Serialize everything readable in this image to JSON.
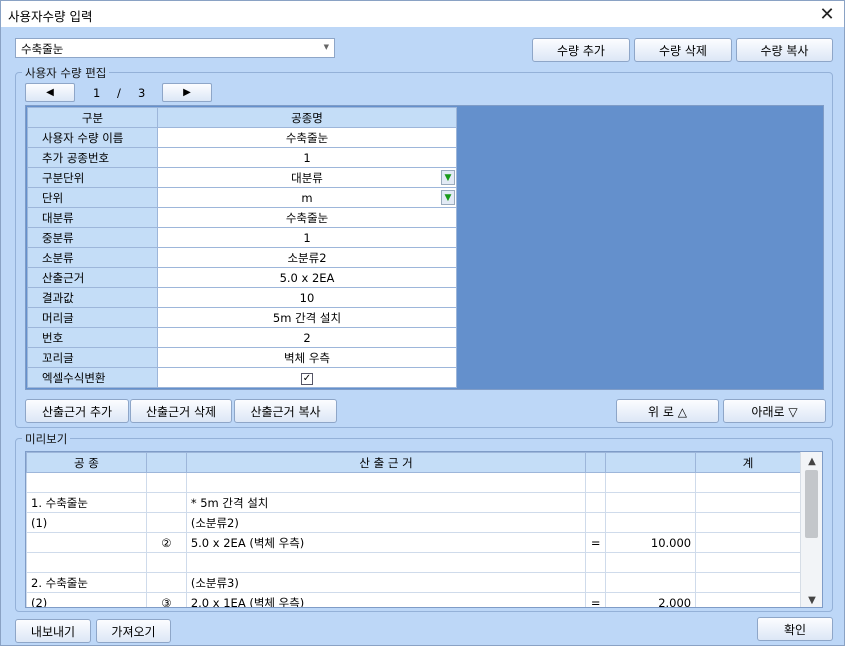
{
  "window": {
    "title": "사용자수량 입력",
    "close_symbol": "✕"
  },
  "selector": {
    "value": "수축줄눈",
    "arrow": "▼"
  },
  "top_buttons": {
    "add": "수량 추가",
    "delete": "수량 삭제",
    "copy": "수량 복사"
  },
  "editor": {
    "group_label": "사용자 수량 편집",
    "prev_symbol": "◀",
    "next_symbol": "▶",
    "page_current": "1",
    "page_sep": "/",
    "page_total": "3",
    "header": {
      "col1": "구분",
      "col2": "공종명"
    },
    "rows": [
      {
        "key": "사용자 수량 이름",
        "value": "수축줄눈"
      },
      {
        "key": "추가 공종번호",
        "value": "1"
      },
      {
        "key": "구분단위",
        "value": "대분류"
      },
      {
        "key": "단위",
        "value": "m"
      },
      {
        "key": "대분류",
        "value": "수축줄눈"
      },
      {
        "key": "중분류",
        "value": "1"
      },
      {
        "key": "소분류",
        "value": "소분류2"
      },
      {
        "key": "산출근거",
        "value": "5.0 x 2EA"
      },
      {
        "key": "결과값",
        "value": "10"
      },
      {
        "key": "머리글",
        "value": "5m 간격 설치"
      },
      {
        "key": "번호",
        "value": "2"
      },
      {
        "key": "꼬리글",
        "value": "벽체 우측"
      },
      {
        "key": "엑셀수식변환",
        "value": ""
      }
    ],
    "dropdown_symbol": "▼",
    "checkbox_symbol": "✓",
    "checkbox_checked": true,
    "actions": {
      "add": "산출근거 추가",
      "delete": "산출근거 삭제",
      "copy": "산출근거 복사",
      "up": "위 로 △",
      "down": "아래로 ▽"
    }
  },
  "preview": {
    "group_label": "미리보기",
    "headers": {
      "c1": "공   종",
      "c2": "",
      "c3": "산  출  근  거",
      "c4": "",
      "c5": "",
      "c6": "계"
    },
    "rows": [
      {
        "c1": "",
        "c2": "",
        "c3": "",
        "c4": "",
        "c5": "",
        "c6": ""
      },
      {
        "c1": "1. 수축줄눈",
        "c2": "",
        "c3": "* 5m 간격 설치",
        "c4": "",
        "c5": "",
        "c6": ""
      },
      {
        "c1": "(1)",
        "c2": "",
        "c3": "(소분류2)",
        "c4": "",
        "c5": "",
        "c6": ""
      },
      {
        "c1": "",
        "c2": "②",
        "c3": "5.0 x 2EA (벽체 우측)",
        "c4": "=",
        "c5": "10.000",
        "c6": ""
      },
      {
        "c1": "",
        "c2": "",
        "c3": "",
        "c4": "",
        "c5": "",
        "c6": ""
      },
      {
        "c1": "2. 수축줄눈",
        "c2": "",
        "c3": "(소분류3)",
        "c4": "",
        "c5": "",
        "c6": ""
      },
      {
        "c1": "(2)",
        "c2": "③",
        "c3": "2.0 x 1EA (벽체 우측)",
        "c4": "=",
        "c5": "2.000",
        "c6": ""
      }
    ],
    "scroll_up": "▲",
    "scroll_down": "▼"
  },
  "footer": {
    "export": "내보내기",
    "import": "가져오기",
    "ok": "확인"
  }
}
